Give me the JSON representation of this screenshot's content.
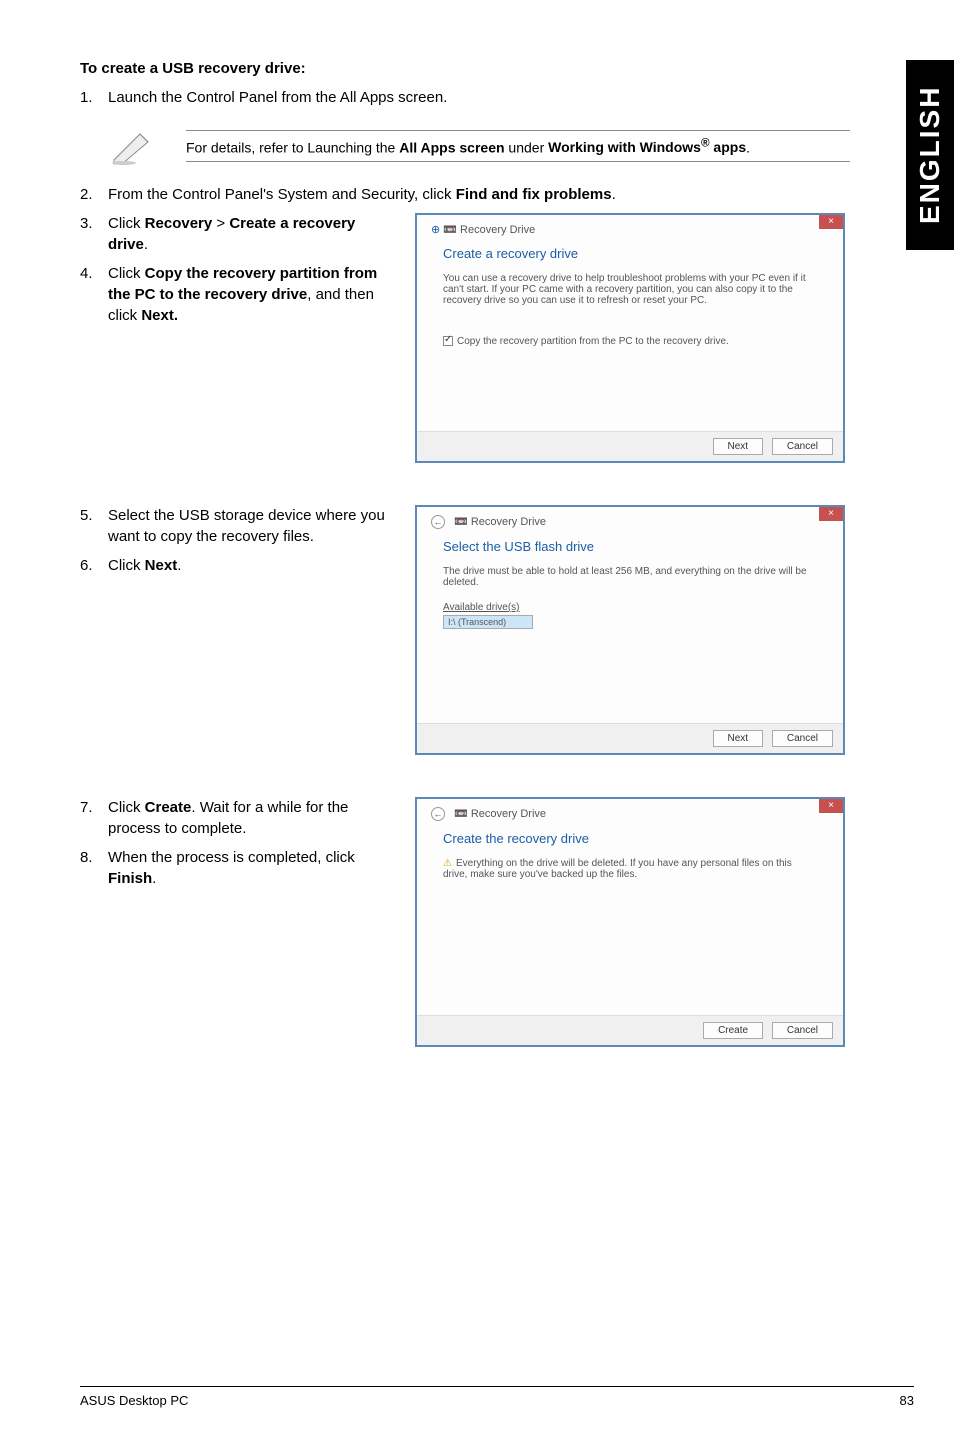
{
  "sideTab": "ENGLISH",
  "sectionTitle": "To create a USB recovery drive:",
  "steps": {
    "s1": {
      "num": "1.",
      "text": "Launch the Control Panel from the All Apps screen."
    },
    "s2": {
      "num": "2.",
      "text_a": "From the Control Panel's System and Security, click ",
      "text_b": "Find and fix problems",
      "text_c": "."
    },
    "s3": {
      "num": "3.",
      "text_a": "Click ",
      "text_b": "Recovery",
      "text_c": " > ",
      "text_d": "Create a recovery drive",
      "text_e": "."
    },
    "s4": {
      "num": "4.",
      "text_a": "Click ",
      "text_b": "Copy the recovery partition from the PC to the recovery drive",
      "text_c": ", and then click ",
      "text_d": "Next."
    },
    "s5": {
      "num": "5.",
      "text": "Select the USB storage device where you want to copy the recovery files."
    },
    "s6": {
      "num": "6.",
      "text_a": "Click ",
      "text_b": "Next",
      "text_c": "."
    },
    "s7": {
      "num": "7.",
      "text_a": "Click ",
      "text_b": "Create",
      "text_c": ". Wait for a while for the process to complete."
    },
    "s8": {
      "num": "8.",
      "text_a": "When the process is completed, click ",
      "text_b": "Finish",
      "text_c": "."
    }
  },
  "note": {
    "pre": "For details, refer to Launching the ",
    "b1": "All Apps screen",
    "mid": " under ",
    "b2": "Working with Windows",
    "sup": "®",
    "b3": " apps",
    "post": "."
  },
  "dialog1": {
    "crumb": "Recovery Drive",
    "title": "Create a recovery drive",
    "desc": "You can use a recovery drive to help troubleshoot problems with your PC even if it can't start. If your PC came with a recovery partition, you can also copy it to the recovery drive so you can use it to refresh or reset your PC.",
    "check": "Copy the recovery partition from the PC to the recovery drive.",
    "next": "Next",
    "cancel": "Cancel"
  },
  "dialog2": {
    "crumb": "Recovery Drive",
    "title": "Select the USB flash drive",
    "desc": "The drive must be able to hold at least 256 MB, and everything on the drive will be deleted.",
    "avail": "Available drive(s)",
    "drive": "I:\\ (Transcend)",
    "next": "Next",
    "cancel": "Cancel"
  },
  "dialog3": {
    "crumb": "Recovery Drive",
    "title": "Create the recovery drive",
    "desc": "Everything on the drive will be deleted. If you have any personal files on this drive, make sure you've backed up the files.",
    "create": "Create",
    "cancel": "Cancel"
  },
  "footer": {
    "left": "ASUS Desktop PC",
    "right": "83"
  }
}
